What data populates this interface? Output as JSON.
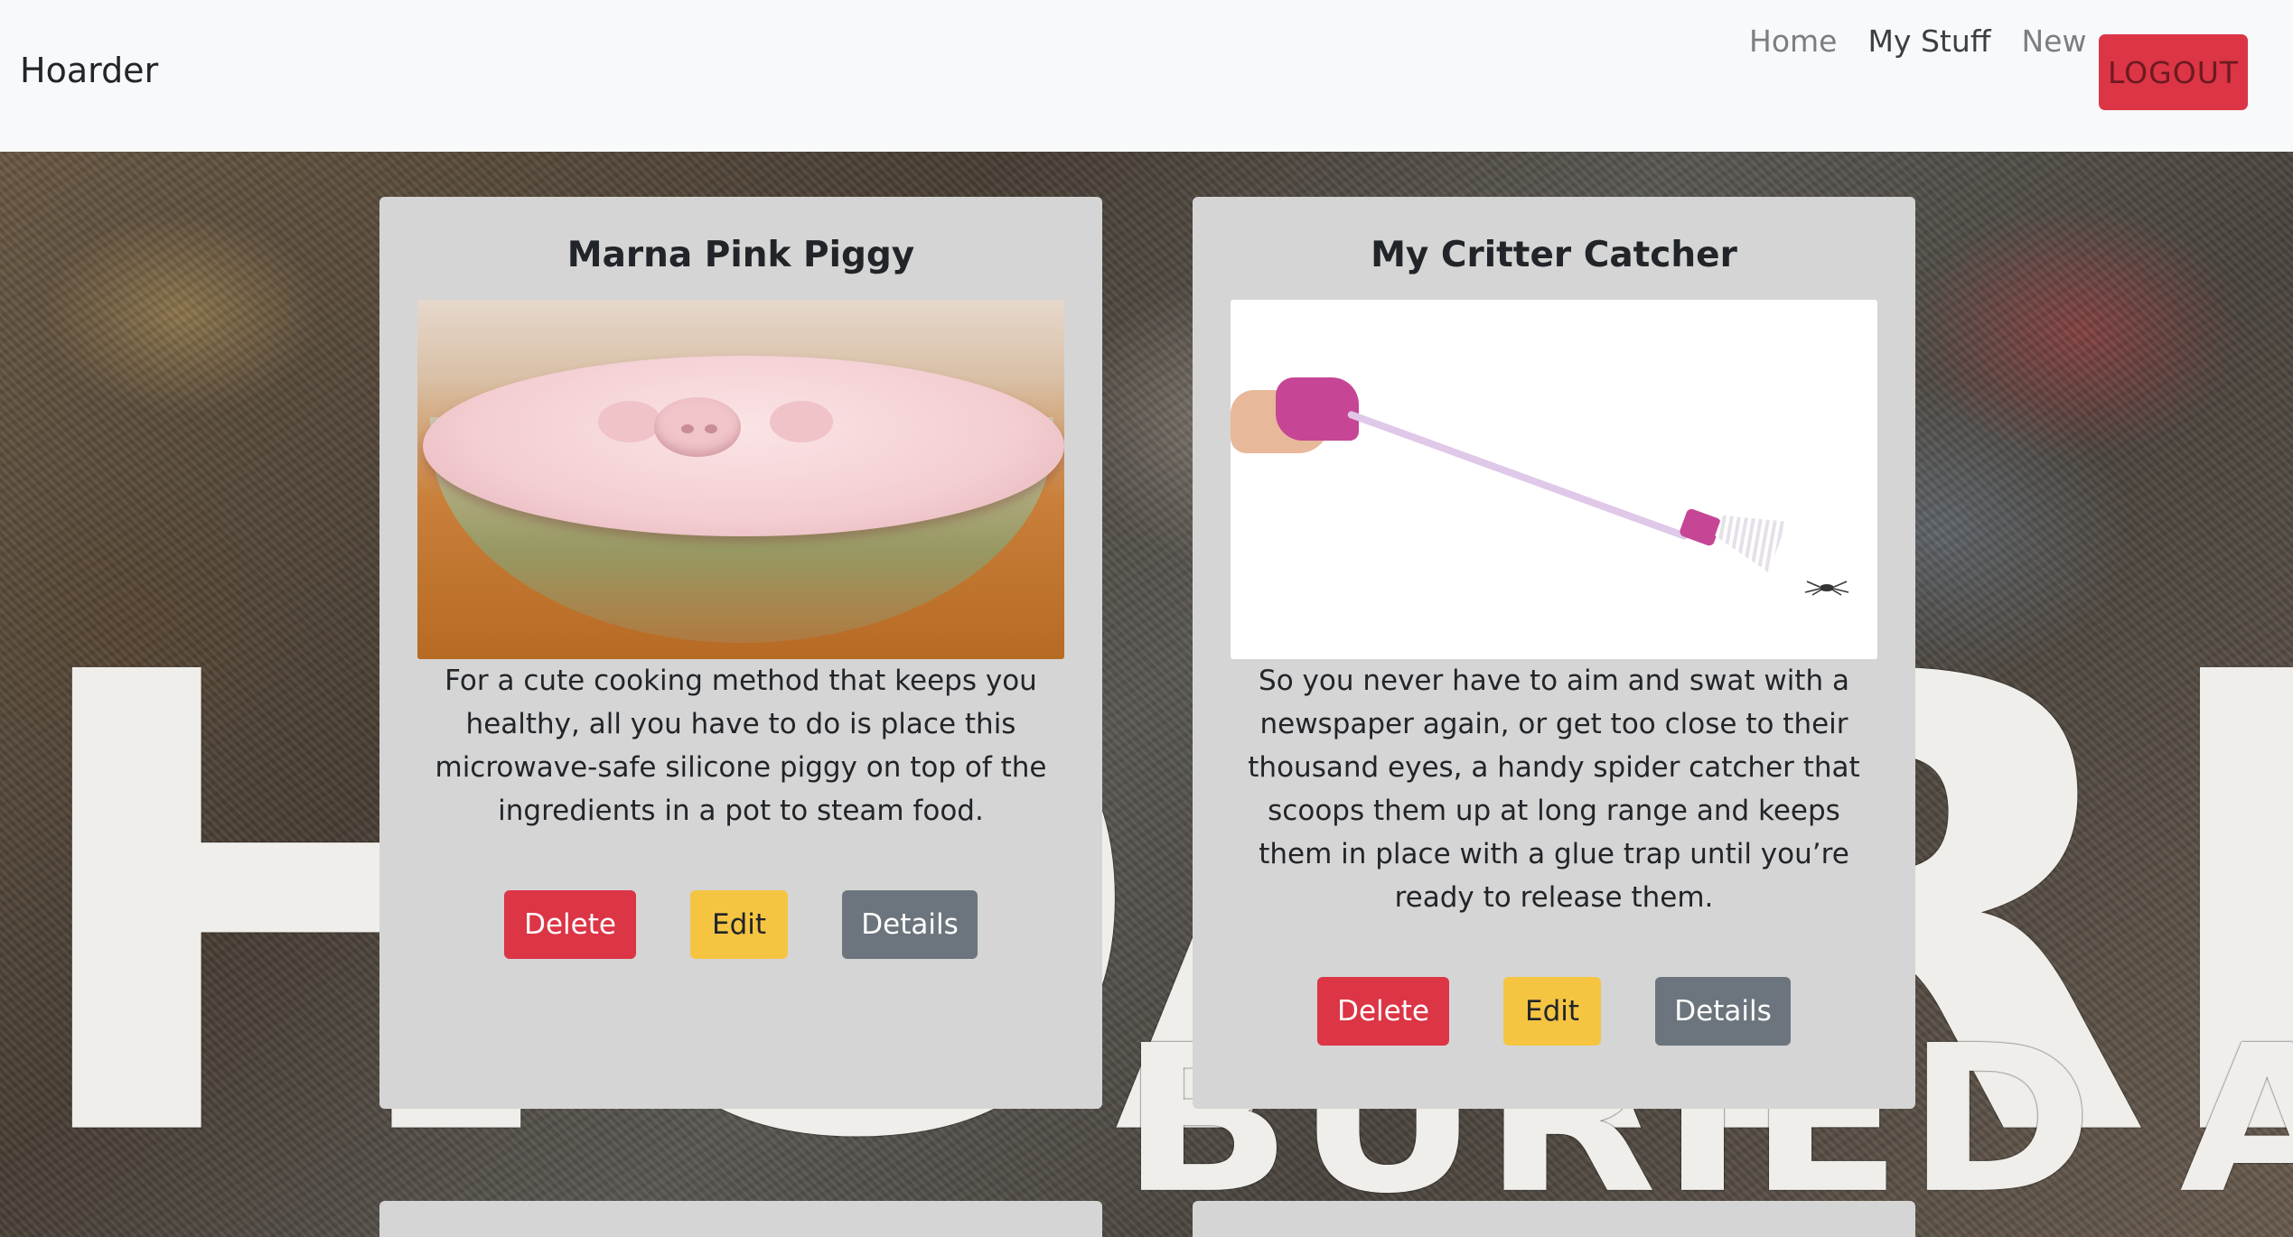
{
  "navbar": {
    "brand": "Hoarder",
    "links": [
      "Home",
      "My Stuff",
      "New"
    ],
    "active_link": "My Stuff",
    "logout_label": "LOGOUT"
  },
  "background": {
    "title": "HOARDING:",
    "subtitle": "BURIED ALIVE"
  },
  "items": [
    {
      "title": "Marna Pink Piggy",
      "description": "For a cute cooking method that keeps you healthy, all you have to do is place this microwave-safe silicone piggy on top of the ingredients in a pot to steam food.",
      "delete_label": "Delete",
      "edit_label": "Edit",
      "details_label": "Details"
    },
    {
      "title": "My Critter Catcher",
      "description": "So you never have to aim and swat with a newspaper again, or get too close to their thousand eyes, a handy spider catcher that scoops them up at long range and keeps them in place with a glue trap until you’re ready to release them.",
      "delete_label": "Delete",
      "edit_label": "Edit",
      "details_label": "Details"
    }
  ],
  "colors": {
    "danger": "#dc3545",
    "warning": "#f5c542",
    "secondary": "#6c757d",
    "navbar_bg": "#f8f9fa",
    "card_bg": "#d5d5d5"
  }
}
